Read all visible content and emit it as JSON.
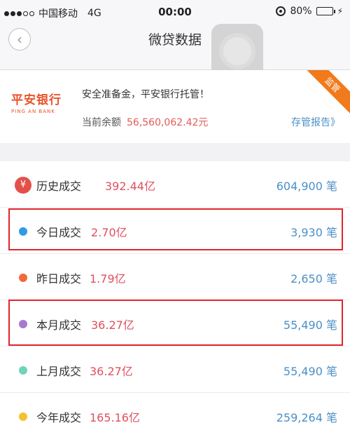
{
  "status_bar": {
    "carrier": "中国移动",
    "network": "4G",
    "time": "00:00",
    "battery": "80%",
    "battery_level": 0.8
  },
  "nav": {
    "title": "微贷数据",
    "back_icon": "chevron-left-icon"
  },
  "bank": {
    "logo_cn": "平安银行",
    "logo_en": "PING AN BANK",
    "notice": "安全准备金，平安银行托管！",
    "balance_label": "当前余额",
    "balance_value": "56,560,062.42元",
    "report_link": "存管报告》",
    "ribbon": "监管"
  },
  "rows": [
    {
      "label": "历史成交",
      "amount": "392.44亿",
      "count": "604,900 笔",
      "marker": "yen-icon",
      "color": "#e3504a"
    },
    {
      "label": "今日成交",
      "amount": "2.70亿",
      "count": "3,930 笔",
      "color": "#2e9be8"
    },
    {
      "label": "昨日成交",
      "amount": "1.79亿",
      "count": "2,650 笔",
      "color": "#f06a3b"
    },
    {
      "label": "本月成交",
      "amount": "36.27亿",
      "count": "55,490 笔",
      "color": "#a77ad1"
    },
    {
      "label": "上月成交",
      "amount": "36.27亿",
      "count": "55,490 笔",
      "color": "#6fd4b8"
    },
    {
      "label": "今年成交",
      "amount": "165.16亿",
      "count": "259,264 笔",
      "color": "#f5c22e"
    }
  ],
  "colors": {
    "accent_red": "#e04f60",
    "link_blue": "#4a90c8",
    "highlight_border": "#e0242c"
  }
}
